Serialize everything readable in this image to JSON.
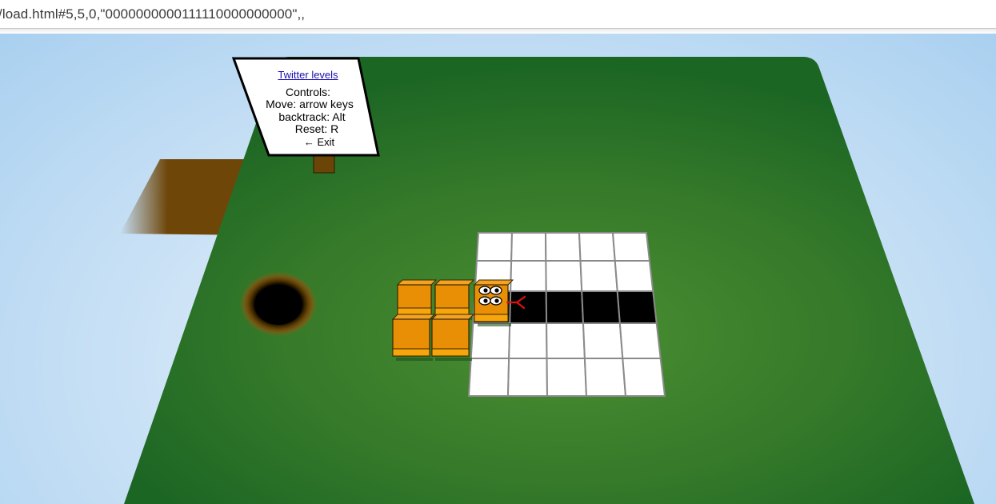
{
  "browser": {
    "address_text": "/load.html#5,5,0,\"0000000000111110000000000\",,"
  },
  "colors": {
    "sky_center": "#e6f1fb",
    "sky_edge": "#a9d0f0",
    "table_light": "#4a8e32",
    "table_dark": "#1c6624",
    "plank": "#6e4608",
    "block": "#e88f05",
    "block_top": "#f2a323",
    "cell_white": "#ffffff",
    "cell_black": "#000000",
    "grid_line": "#8a8a8a",
    "tongue": "#e01010",
    "link": "#1a0dab"
  },
  "sign": {
    "link_text": "Twitter levels",
    "controls_title": "Controls:",
    "move_text": "Move: arrow keys",
    "backtrack_text": "backtrack: Alt",
    "reset_text": "Reset: R",
    "exit_text": "← Exit"
  },
  "level": {
    "grid_cols": 5,
    "grid_rows": 5,
    "cell_pattern": "0000000000111110000000000",
    "snake_segments": 5
  },
  "icons": {
    "snake_eyes": "eyes-icon",
    "snake_tongue": "forked-tongue-icon",
    "exit_hole": "black-hole-icon"
  }
}
